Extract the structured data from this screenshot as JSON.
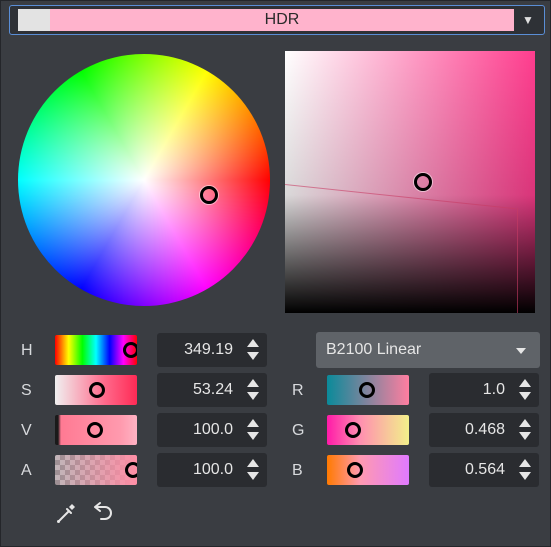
{
  "header": {
    "mode_label": "HDR",
    "old_color": "#e3e3e3",
    "new_color": "#ffb3cc",
    "dropdown_icon": "chevron-down-icon"
  },
  "hsva": {
    "h": {
      "label": "H",
      "value": "349.19"
    },
    "s": {
      "label": "S",
      "value": "53.24"
    },
    "v": {
      "label": "V",
      "value": "100.0"
    },
    "a": {
      "label": "A",
      "value": "100.0"
    }
  },
  "rgb": {
    "mode": "B2100 Linear",
    "r": {
      "label": "R",
      "value": "1.0"
    },
    "g": {
      "label": "G",
      "value": "0.468"
    },
    "b": {
      "label": "B",
      "value": "0.564"
    }
  },
  "tools": {
    "picker_icon": "eyedropper-icon",
    "reset_icon": "undo-icon"
  },
  "colors": {
    "accent": "#5a8ed6",
    "panel": "#3a3d42",
    "field": "#2a2c30"
  }
}
